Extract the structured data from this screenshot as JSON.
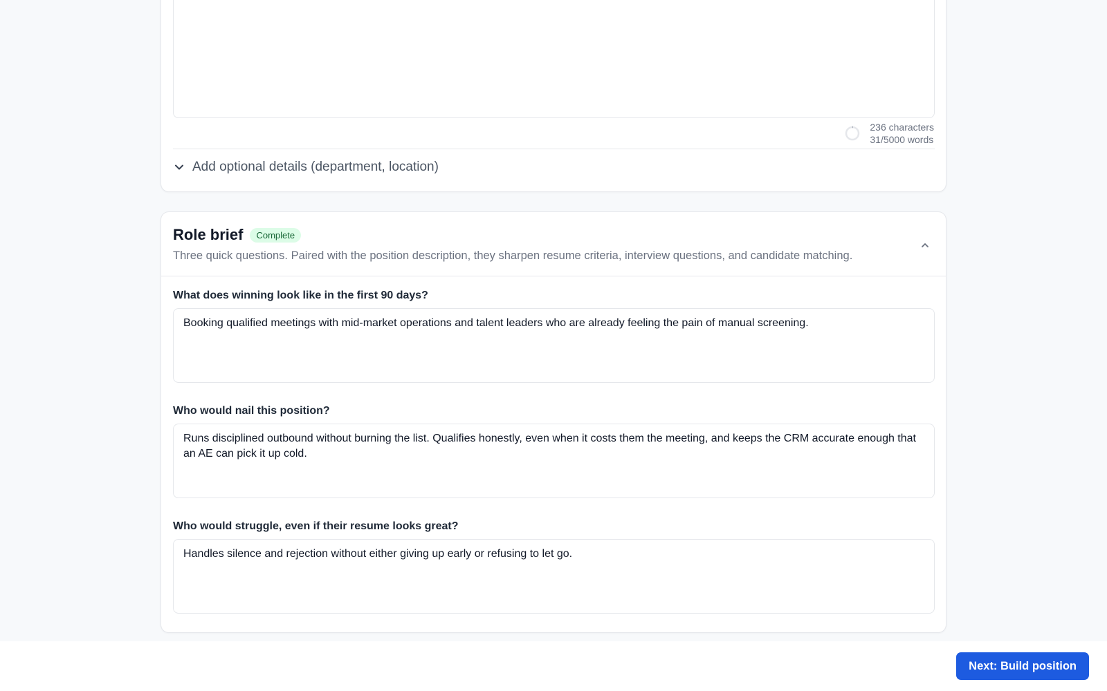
{
  "description_card": {
    "characters": "236 characters",
    "words": "31/5000 words",
    "optional_toggle_label": "Add optional details (department, location)"
  },
  "role_brief": {
    "title": "Role brief",
    "status_badge": "Complete",
    "subtitle": "Three quick questions. Paired with the position description, they sharpen resume criteria, interview questions, and candidate matching.",
    "questions": [
      {
        "label": "What does winning look like in the first 90 days?",
        "answer": "Booking qualified meetings with mid-market operations and talent leaders who are already feeling the pain of manual screening."
      },
      {
        "label": "Who would nail this position?",
        "answer": "Runs disciplined outbound without burning the list. Qualifies honestly, even when it costs them the meeting, and keeps the CRM accurate enough that an AE can pick it up cold."
      },
      {
        "label": "Who would struggle, even if their resume looks great?",
        "answer": "Handles silence and rejection without either giving up early or refusing to let go."
      }
    ]
  },
  "footer": {
    "next_button": "Next: Build position"
  },
  "colors": {
    "accent": "#1d5be0",
    "badge_bg": "#dcfce7",
    "badge_text": "#166534",
    "page_bg": "#f7f9fb"
  }
}
